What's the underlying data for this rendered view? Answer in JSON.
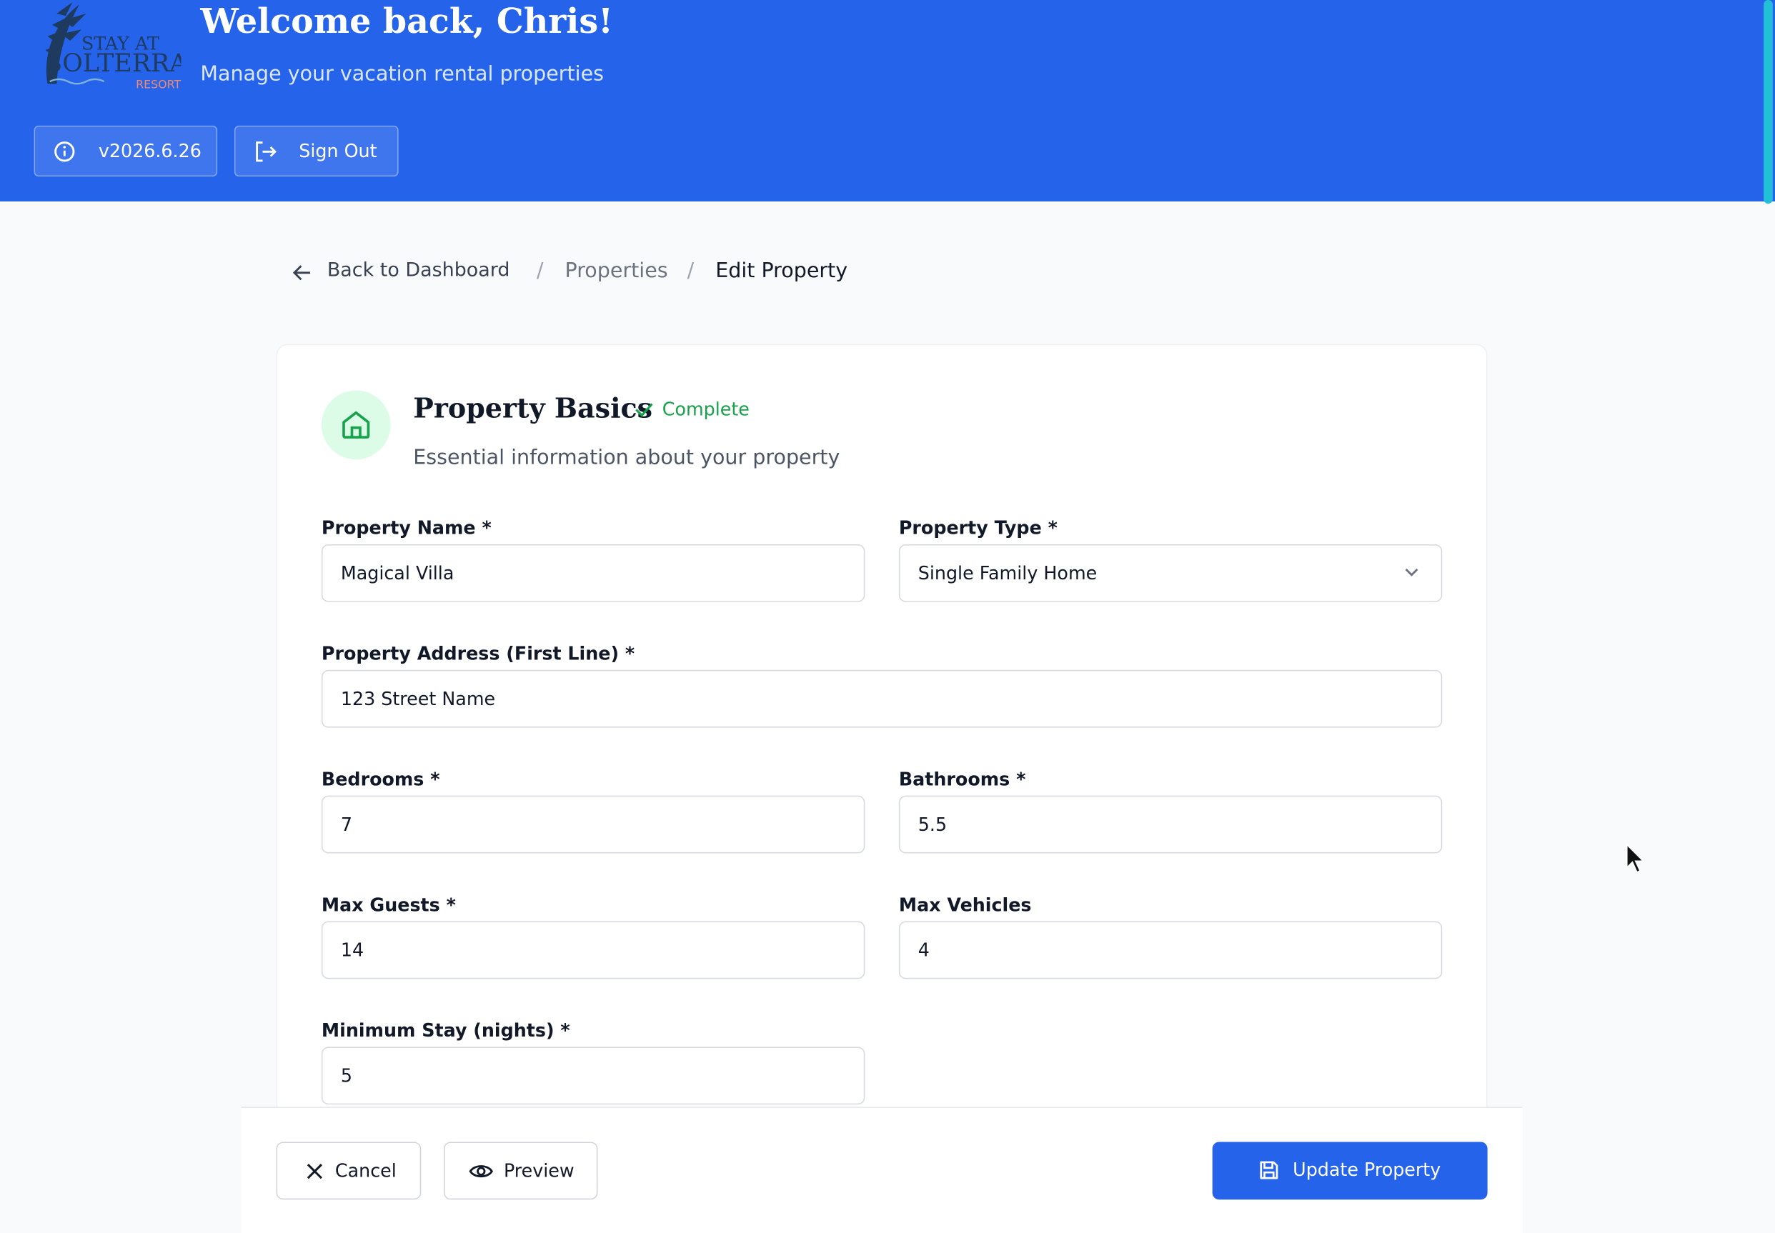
{
  "header": {
    "logo": {
      "line1": "STAY AT",
      "line2": "SOLTERRA",
      "line3": "RESORT"
    },
    "welcome": "Welcome back, Chris!",
    "subtitle": "Manage your vacation rental properties",
    "version_label": "v2026.6.26",
    "sign_out_label": "Sign Out"
  },
  "breadcrumb": {
    "back_label": "Back to Dashboard",
    "separator": "/",
    "properties": "Properties",
    "current": "Edit Property"
  },
  "section": {
    "title": "Property Basics",
    "status": "Complete",
    "description": "Essential information about your property"
  },
  "form": {
    "property_name": {
      "label": "Property Name *",
      "value": "Magical Villa"
    },
    "property_type": {
      "label": "Property Type *",
      "value": "Single Family Home"
    },
    "address": {
      "label": "Property Address (First Line) *",
      "value": "123 Street Name"
    },
    "bedrooms": {
      "label": "Bedrooms *",
      "value": "7"
    },
    "bathrooms": {
      "label": "Bathrooms *",
      "value": "5.5"
    },
    "max_guests": {
      "label": "Max Guests *",
      "value": "14"
    },
    "max_vehicles": {
      "label": "Max Vehicles",
      "value": "4"
    },
    "min_stay": {
      "label": "Minimum Stay (nights) *",
      "value": "5"
    }
  },
  "footer": {
    "cancel_label": "Cancel",
    "preview_label": "Preview",
    "update_label": "Update Property"
  },
  "colors": {
    "brand_blue": "#2563eb",
    "success_green": "#16a34a",
    "logo_navy": "#1e3a5f",
    "logo_coral": "#f08a6b"
  }
}
